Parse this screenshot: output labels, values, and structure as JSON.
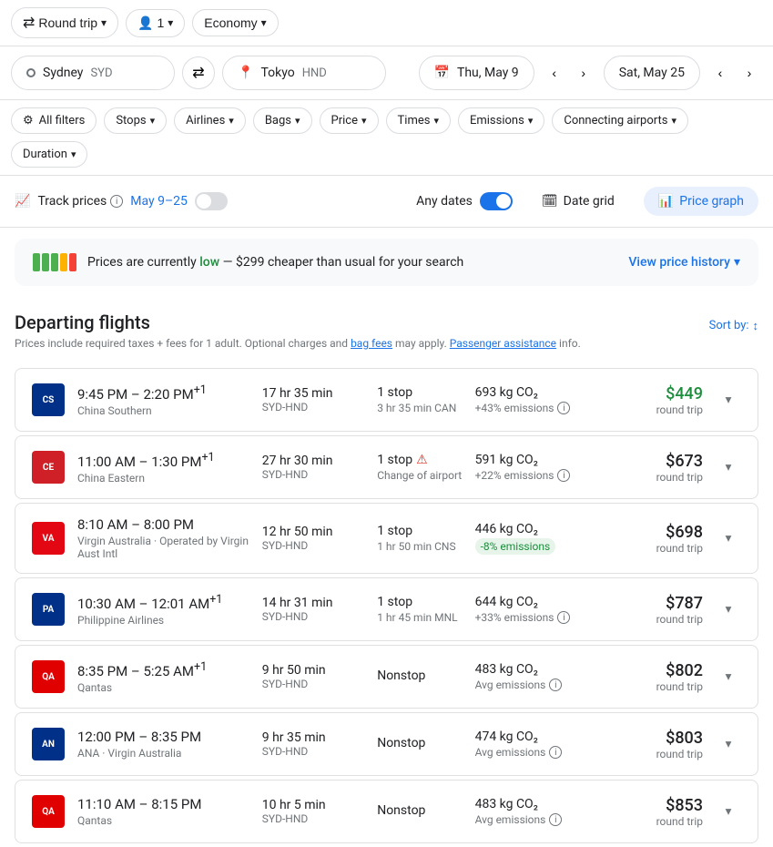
{
  "topnav": {
    "trip_type": "Round trip",
    "passengers": "1",
    "cabin": "Economy"
  },
  "search": {
    "origin_name": "Sydney",
    "origin_code": "SYD",
    "dest_name": "Tokyo",
    "dest_code": "HND",
    "depart_date": "Thu, May 9",
    "return_date": "Sat, May 25"
  },
  "filters": {
    "all_filters": "All filters",
    "stops": "Stops",
    "airlines": "Airlines",
    "bags": "Bags",
    "price": "Price",
    "times": "Times",
    "emissions": "Emissions",
    "connecting_airports": "Connecting airports",
    "duration": "Duration"
  },
  "track": {
    "label": "Track prices",
    "date_range": "May 9–25",
    "any_dates": "Any dates",
    "date_grid": "Date grid",
    "price_graph": "Price graph"
  },
  "banner": {
    "text_before": "Prices are currently",
    "low_text": "low",
    "text_after": "— $299 cheaper than usual for your search",
    "view_history": "View price history"
  },
  "flights_section": {
    "title": "Departing flights",
    "subtitle": "Prices include required taxes + fees for 1 adult. Optional charges and",
    "subtitle_link": "bag fees",
    "subtitle_end": "may apply.",
    "passenger_link": "Passenger assistance",
    "subtitle_info": "info.",
    "sort_by": "Sort by:"
  },
  "flights": [
    {
      "id": 1,
      "logo_code": "CS",
      "logo_color": "#003087",
      "time_range": "9:45 PM – 2:20 PM",
      "time_super": "+1",
      "airline": "China Southern",
      "duration": "17 hr 35 min",
      "route": "SYD-HND",
      "stops": "1 stop",
      "stop_detail": "3 hr 35 min CAN",
      "emissions": "693 kg CO₂",
      "emissions_pct": "+43% emissions",
      "price": "$449",
      "price_type": "round trip",
      "is_low_price": true,
      "has_warning": false,
      "negative_emissions": false
    },
    {
      "id": 2,
      "logo_code": "CE",
      "logo_color": "#d02027",
      "time_range": "11:00 AM – 1:30 PM",
      "time_super": "+1",
      "airline": "China Eastern",
      "duration": "27 hr 30 min",
      "route": "SYD-HND",
      "stops": "1 stop",
      "stop_detail": "Change of airport",
      "emissions": "591 kg CO₂",
      "emissions_pct": "+22% emissions",
      "price": "$673",
      "price_type": "round trip",
      "is_low_price": false,
      "has_warning": true,
      "negative_emissions": false
    },
    {
      "id": 3,
      "logo_code": "VA",
      "logo_color": "#e30613",
      "time_range": "8:10 AM – 8:00 PM",
      "time_super": "",
      "airline": "Virgin Australia · Operated by Virgin Aust Intl",
      "duration": "12 hr 50 min",
      "route": "SYD-HND",
      "stops": "1 stop",
      "stop_detail": "1 hr 50 min CNS",
      "emissions": "446 kg CO₂",
      "emissions_pct": "-8% emissions",
      "price": "$698",
      "price_type": "round trip",
      "is_low_price": false,
      "has_warning": false,
      "negative_emissions": true
    },
    {
      "id": 4,
      "logo_code": "PA",
      "logo_color": "#003087",
      "time_range": "10:30 AM – 12:01 AM",
      "time_super": "+1",
      "airline": "Philippine Airlines",
      "duration": "14 hr 31 min",
      "route": "SYD-HND",
      "stops": "1 stop",
      "stop_detail": "1 hr 45 min MNL",
      "emissions": "644 kg CO₂",
      "emissions_pct": "+33% emissions",
      "price": "$787",
      "price_type": "round trip",
      "is_low_price": false,
      "has_warning": false,
      "negative_emissions": false
    },
    {
      "id": 5,
      "logo_code": "QA",
      "logo_color": "#e10000",
      "time_range": "8:35 PM – 5:25 AM",
      "time_super": "+1",
      "airline": "Qantas",
      "duration": "9 hr 50 min",
      "route": "SYD-HND",
      "stops": "Nonstop",
      "stop_detail": "",
      "emissions": "483 kg CO₂",
      "emissions_pct": "Avg emissions",
      "price": "$802",
      "price_type": "round trip",
      "is_low_price": false,
      "has_warning": false,
      "negative_emissions": false
    },
    {
      "id": 6,
      "logo_code": "AN",
      "logo_color": "#003087",
      "time_range": "12:00 PM – 8:35 PM",
      "time_super": "",
      "airline": "ANA · Virgin Australia",
      "duration": "9 hr 35 min",
      "route": "SYD-HND",
      "stops": "Nonstop",
      "stop_detail": "",
      "emissions": "474 kg CO₂",
      "emissions_pct": "Avg emissions",
      "price": "$803",
      "price_type": "round trip",
      "is_low_price": false,
      "has_warning": false,
      "negative_emissions": false
    },
    {
      "id": 7,
      "logo_code": "QA",
      "logo_color": "#e10000",
      "time_range": "11:10 AM – 8:15 PM",
      "time_super": "",
      "airline": "Qantas",
      "duration": "10 hr 5 min",
      "route": "SYD-HND",
      "stops": "Nonstop",
      "stop_detail": "",
      "emissions": "483 kg CO₂",
      "emissions_pct": "Avg emissions",
      "price": "$853",
      "price_type": "round trip",
      "is_low_price": false,
      "has_warning": false,
      "negative_emissions": false
    }
  ]
}
